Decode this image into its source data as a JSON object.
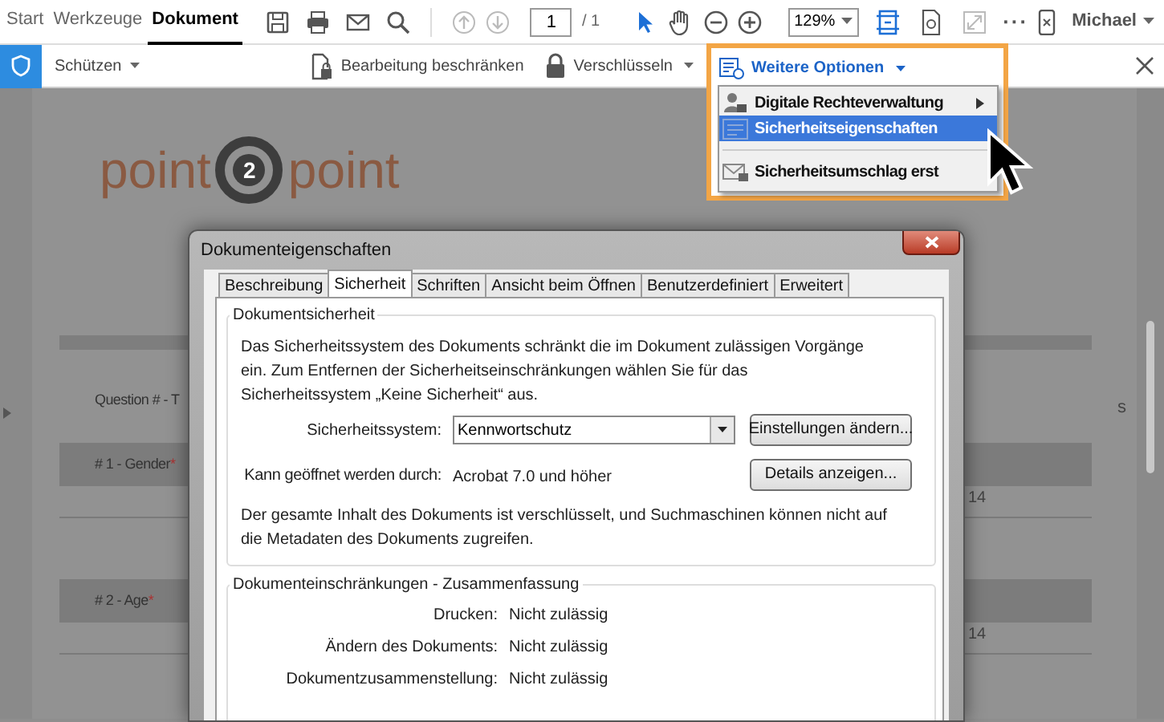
{
  "nav_tabs": [
    {
      "label": "Start",
      "selected": false
    },
    {
      "label": "Werkzeuge",
      "selected": false
    },
    {
      "label": "Dokument",
      "selected": true
    }
  ],
  "toolbar": {
    "page_number": "1",
    "page_total": "/ 1",
    "zoom": "129%",
    "more": "···",
    "user": "Michael"
  },
  "protect_bar": {
    "title": "Schützen",
    "actions": [
      {
        "label": "Bearbeitung beschränken",
        "kind": "restrict",
        "dropdown": false
      },
      {
        "label": "Verschlüsseln",
        "kind": "encrypt",
        "dropdown": true
      }
    ]
  },
  "options_menu": {
    "title": "Weitere Optionen",
    "items": [
      {
        "label": "Digitale Rechteverwaltung",
        "selected": false,
        "submenu": true,
        "kind": "rights"
      },
      {
        "label": "Sicherheitseigenschaften",
        "selected": true,
        "submenu": false,
        "kind": "properties"
      },
      {
        "label": "Sicherheitsumschlag erst",
        "selected": false,
        "submenu": false,
        "kind": "envelope"
      }
    ]
  },
  "document": {
    "logo": {
      "left": "point",
      "number": "2",
      "right": "point"
    },
    "column_edge": "s",
    "rows": [
      {
        "label": "Question # - T",
        "band": false
      },
      {
        "label": "# 1 - Gender",
        "required_mark": "*",
        "band": true,
        "value": "14"
      },
      {
        "label": "# 2 - Age",
        "required_mark": "*",
        "band": true,
        "value": "14"
      }
    ]
  },
  "dialog": {
    "title": "Dokumenteigenschaften",
    "tabs": [
      {
        "label": "Beschreibung",
        "selected": false
      },
      {
        "label": "Sicherheit",
        "selected": true
      },
      {
        "label": "Schriften",
        "selected": false
      },
      {
        "label": "Ansicht beim Öffnen",
        "selected": false
      },
      {
        "label": "Benutzerdefiniert",
        "selected": false
      },
      {
        "label": "Erweitert",
        "selected": false
      }
    ],
    "security": {
      "legend": "Dokumentsicherheit",
      "intro": "Das Sicherheitssystem des Dokuments schränkt die im Dokument zulässigen Vorgänge ein. Zum Entfernen der Sicherheitseinschränkungen wählen Sie für das Sicherheitssystem „Keine Sicherheit“ aus.",
      "system_label": "Sicherheitssystem:",
      "system_value": "Kennwortschutz",
      "settings_button": "Einstellungen ändern...",
      "open_label": "Kann geöffnet werden durch:",
      "open_value": "Acrobat 7.0 und höher",
      "details_button": "Details anzeigen...",
      "note": "Der gesamte Inhalt des Dokuments ist verschlüsselt, und Suchmaschinen können nicht auf die Metadaten des Dokuments zugreifen."
    },
    "restrictions": {
      "legend": "Dokumenteinschränkungen - Zusammenfassung",
      "rows": [
        {
          "label": "Drucken:",
          "value": "Nicht zulässig"
        },
        {
          "label": "Ändern des Dokuments:",
          "value": "Nicht zulässig"
        },
        {
          "label": "Dokumentzusammenstellung:",
          "value": "Nicht zulässig"
        }
      ]
    }
  }
}
